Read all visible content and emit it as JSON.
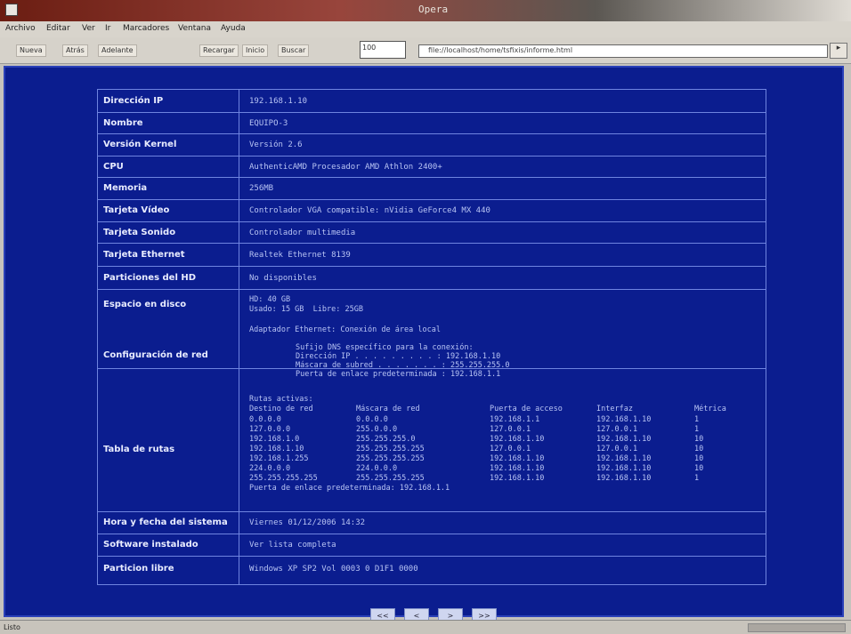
{
  "window": {
    "title": "Opera"
  },
  "menu": [
    "Archivo",
    "Editar",
    "Ver",
    "Ir",
    "Marcadores",
    "Ventana",
    "Ayuda"
  ],
  "toolbar": {
    "buttons": [
      "Nueva",
      "Atrás",
      "Adelante",
      "Recargar",
      "Inicio",
      "Buscar"
    ],
    "zoom": "100",
    "address": "file://localhost/home/tsfixis/informe.html"
  },
  "info": {
    "rows": [
      {
        "label": "Dirección IP",
        "value": "192.168.1.10"
      },
      {
        "label": "Nombre",
        "value": "EQUIPO-3"
      },
      {
        "label": "Versión Kernel",
        "value": "Versión 2.6"
      },
      {
        "label": "CPU",
        "value": "AuthenticAMD Procesador AMD Athlon 2400+"
      },
      {
        "label": "Memoria",
        "value": "256MB"
      },
      {
        "label": "Tarjeta Vídeo",
        "value": "Controlador VGA compatible: nVidia GeForce4 MX 440"
      },
      {
        "label": "Tarjeta Sonido",
        "value": "Controlador multimedia"
      },
      {
        "label": "Tarjeta Ethernet",
        "value": "Realtek Ethernet 8139"
      },
      {
        "label": "Particiones del HD",
        "value": "No disponibles"
      }
    ],
    "disk": {
      "label": "Espacio en disco",
      "lines": [
        "HD: 40 GB",
        "Usado: 15 GB  Libre: 25GB"
      ]
    },
    "net": {
      "label": "Configuración de red",
      "heading": "Adaptador Ethernet: Conexión de área local",
      "lines": [
        "Sufijo DNS específico para la conexión:",
        "Dirección IP . . . . . . . . . : 192.168.1.10",
        "Máscara de subred . . . . . . . : 255.255.255.0",
        "Puerta de enlace predeterminada : 192.168.1.1"
      ]
    },
    "routes": {
      "label": "Tabla de rutas",
      "header": "Rutas activas:",
      "columns": [
        "Destino de red",
        "Máscara de red",
        "Puerta de acceso",
        "Interfaz",
        "Métrica"
      ],
      "rows": [
        [
          "0.0.0.0",
          "0.0.0.0",
          "192.168.1.1",
          "192.168.1.10",
          "1"
        ],
        [
          "127.0.0.0",
          "255.0.0.0",
          "127.0.0.1",
          "127.0.0.1",
          "1"
        ],
        [
          "192.168.1.0",
          "255.255.255.0",
          "192.168.1.10",
          "192.168.1.10",
          "10"
        ],
        [
          "192.168.1.10",
          "255.255.255.255",
          "127.0.0.1",
          "127.0.0.1",
          "10"
        ],
        [
          "192.168.1.255",
          "255.255.255.255",
          "192.168.1.10",
          "192.168.1.10",
          "10"
        ],
        [
          "224.0.0.0",
          "224.0.0.0",
          "192.168.1.10",
          "192.168.1.10",
          "10"
        ],
        [
          "255.255.255.255",
          "255.255.255.255",
          "192.168.1.10",
          "192.168.1.10",
          "1"
        ]
      ],
      "footer": "Puerta de enlace predeterminada: 192.168.1.1"
    },
    "tail": [
      {
        "label": "Hora y fecha del sistema",
        "value": "Viernes 01/12/2006 14:32"
      },
      {
        "label": "Software instalado",
        "value": "Ver lista completa"
      },
      {
        "label": "Particion libre",
        "value": "Windows XP SP2 Vol 0003 0 D1F1 0000"
      }
    ]
  },
  "nav": [
    "<<",
    "<",
    ">",
    ">>"
  ],
  "status": {
    "text": "Listo"
  }
}
